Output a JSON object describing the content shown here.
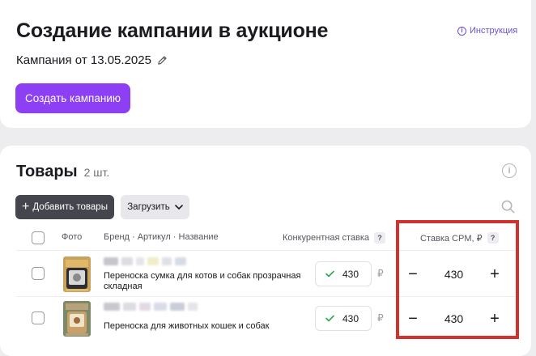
{
  "header": {
    "title": "Создание кампании в аукционе",
    "instruction_label": "Инструкция",
    "campaign_name": "Кампания от 13.05.2025",
    "create_button_label": "Создать кампанию"
  },
  "goods": {
    "title": "Товары",
    "count": "2 шт.",
    "add_button_label": "Добавить товары",
    "upload_button_label": "Загрузить",
    "columns": {
      "photo": "Фото",
      "brand": "Бренд · Артикул · Название",
      "competitive_bid": "Конкурентная ставка",
      "cpm_bid": "Ставка CPM, ₽"
    },
    "rows": [
      {
        "name": "Переноска сумка для котов и собак прозрачная складная",
        "competitive_bid": "430",
        "currency": "₽",
        "cpm_bid": "430"
      },
      {
        "name": "Переноска для животных кошек и собак",
        "competitive_bid": "430",
        "currency": "₽",
        "cpm_bid": "430"
      }
    ]
  },
  "icons": {
    "info": "info-icon",
    "edit": "pencil-icon",
    "search": "search-icon",
    "chevron": "chevron-down-icon",
    "check": "check-icon"
  },
  "colors": {
    "primary": "#8c3ff3",
    "dark_button": "#45454d",
    "link": "#6b4fd8",
    "highlight": "#d0322d",
    "check": "#2fa84f"
  }
}
